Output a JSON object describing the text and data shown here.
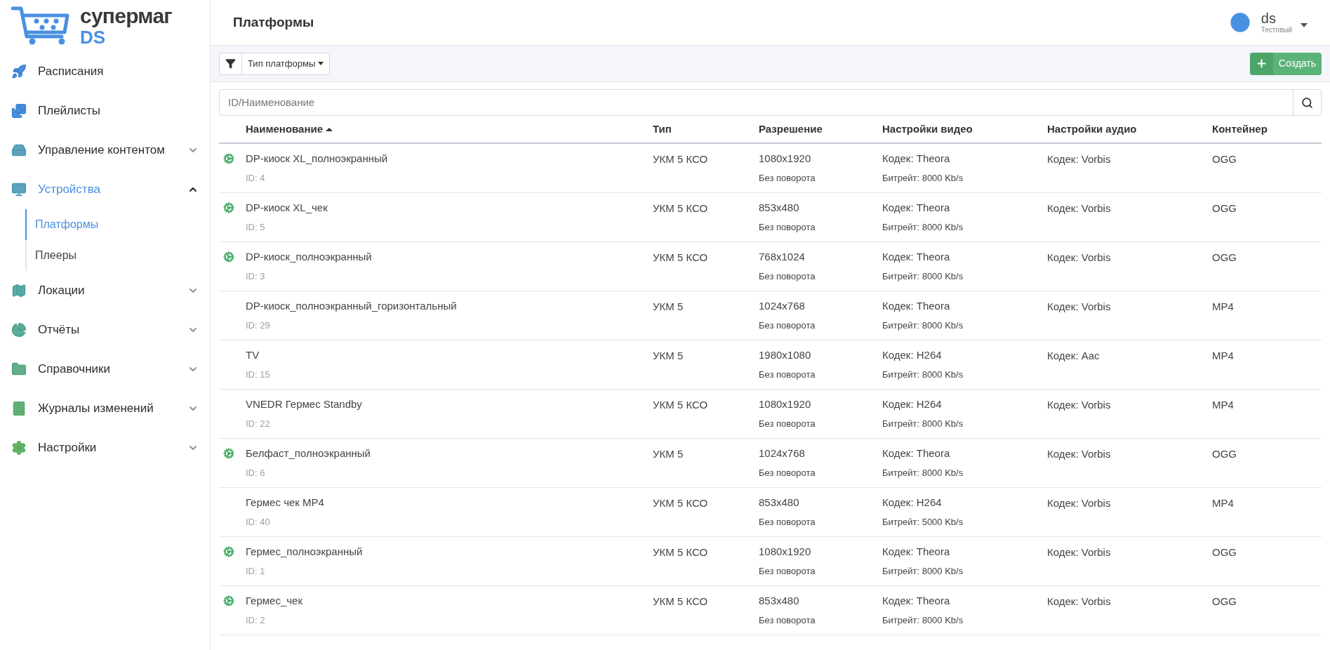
{
  "logo": {
    "line_1": "супермаг",
    "line_2": "DS"
  },
  "sidebar": {
    "items": [
      {
        "label": "Расписания",
        "selected": false
      },
      {
        "label": "Плейлисты",
        "selected": false
      },
      {
        "label": "Управление контентом",
        "selected": false,
        "expanded": false
      },
      {
        "label": "Устройства",
        "selected": true,
        "expanded": true,
        "children": [
          {
            "label": "Платформы",
            "selected": true
          },
          {
            "label": "Плееры",
            "selected": false
          }
        ]
      },
      {
        "label": "Локации",
        "selected": false,
        "expanded": false
      },
      {
        "label": "Отчёты",
        "selected": false,
        "expanded": false
      },
      {
        "label": "Справочники",
        "selected": false,
        "expanded": false
      },
      {
        "label": "Журналы изменений",
        "selected": false,
        "expanded": false
      },
      {
        "label": "Настройки",
        "selected": false,
        "expanded": false
      }
    ]
  },
  "header": {
    "title": "Платформы",
    "user": {
      "name": "ds",
      "role": "Тестовый"
    }
  },
  "toolbar": {
    "filter_label": "Тип платформы",
    "create_button": "Создать"
  },
  "search": {
    "placeholder": "ID/Наименование"
  },
  "table": {
    "columns": [
      {
        "label": "Наименование",
        "sorted": true
      },
      {
        "label": "Тип",
        "sorted": false
      },
      {
        "label": "Разрешение",
        "sorted": false
      },
      {
        "label": "Настройки видео",
        "sorted": false
      },
      {
        "label": "Настройки аудио",
        "sorted": false
      },
      {
        "label": "Контейнер",
        "sorted": false
      }
    ],
    "rows": [
      {
        "configured": true,
        "name": "DP-киоск XL_полноэкранный",
        "id": "ID: 4",
        "type": "УКМ 5 КСО",
        "resolution": "1080x1920",
        "rotation": "Без поворота",
        "video_codec": "Кодек: Theora",
        "bitrate": "Битрейт: 8000 Kb/s",
        "audio": "Кодек: Vorbis",
        "container": "OGG"
      },
      {
        "configured": true,
        "name": "DP-киоск XL_чек",
        "id": "ID: 5",
        "type": "УКМ 5 КСО",
        "resolution": "853x480",
        "rotation": "Без поворота",
        "video_codec": "Кодек: Theora",
        "bitrate": "Битрейт: 8000 Kb/s",
        "audio": "Кодек: Vorbis",
        "container": "OGG"
      },
      {
        "configured": true,
        "name": "DP-киоск_полноэкранный",
        "id": "ID: 3",
        "type": "УКМ 5 КСО",
        "resolution": "768x1024",
        "rotation": "Без поворота",
        "video_codec": "Кодек: Theora",
        "bitrate": "Битрейт: 8000 Kb/s",
        "audio": "Кодек: Vorbis",
        "container": "OGG"
      },
      {
        "configured": false,
        "name": "DP-киоск_полноэкранный_горизонтальный",
        "id": "ID: 29",
        "type": "УКМ 5",
        "resolution": "1024x768",
        "rotation": "Без поворота",
        "video_codec": "Кодек: Theora",
        "bitrate": "Битрейт: 8000 Kb/s",
        "audio": "Кодек: Vorbis",
        "container": "MP4"
      },
      {
        "configured": false,
        "name": "TV",
        "id": "ID: 15",
        "type": "УКМ 5",
        "resolution": "1980x1080",
        "rotation": "Без поворота",
        "video_codec": "Кодек: H264",
        "bitrate": "Битрейт: 8000 Kb/s",
        "audio": "Кодек: Aac",
        "container": "MP4"
      },
      {
        "configured": false,
        "name": "VNEDR Гермес Standby",
        "id": "ID: 22",
        "type": "УКМ 5 КСО",
        "resolution": "1080x1920",
        "rotation": "Без поворота",
        "video_codec": "Кодек: H264",
        "bitrate": "Битрейт: 8000 Kb/s",
        "audio": "Кодек: Vorbis",
        "container": "MP4"
      },
      {
        "configured": true,
        "name": "Белфаст_полноэкранный",
        "id": "ID: 6",
        "type": "УКМ 5",
        "resolution": "1024x768",
        "rotation": "Без поворота",
        "video_codec": "Кодек: Theora",
        "bitrate": "Битрейт: 8000 Kb/s",
        "audio": "Кодек: Vorbis",
        "container": "OGG"
      },
      {
        "configured": false,
        "name": "Гермес чек MP4",
        "id": "ID: 40",
        "type": "УКМ 5 КСО",
        "resolution": "853x480",
        "rotation": "Без поворота",
        "video_codec": "Кодек: H264",
        "bitrate": "Битрейт: 5000 Kb/s",
        "audio": "Кодек: Vorbis",
        "container": "MP4"
      },
      {
        "configured": true,
        "name": "Гермес_полноэкранный",
        "id": "ID: 1",
        "type": "УКМ 5 КСО",
        "resolution": "1080x1920",
        "rotation": "Без поворота",
        "video_codec": "Кодек: Theora",
        "bitrate": "Битрейт: 8000 Kb/s",
        "audio": "Кодек: Vorbis",
        "container": "OGG"
      },
      {
        "configured": true,
        "name": "Гермес_чек",
        "id": "ID: 2",
        "type": "УКМ 5 КСО",
        "resolution": "853x480",
        "rotation": "Без поворота",
        "video_codec": "Кодек: Theora",
        "bitrate": "Битрейт: 8000 Kb/s",
        "audio": "Кодек: Vorbis",
        "container": "OGG"
      }
    ]
  }
}
